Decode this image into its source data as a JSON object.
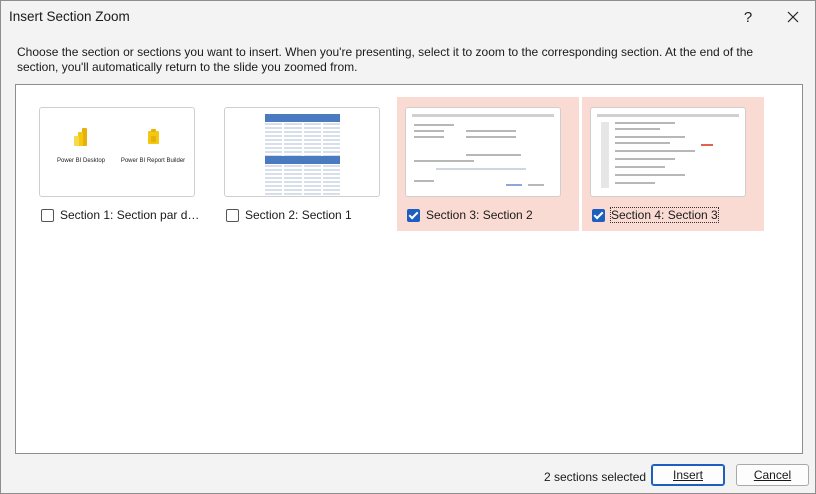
{
  "window": {
    "title": "Insert Section Zoom",
    "help_label": "?",
    "close_label": "✕"
  },
  "instruction": "Choose the section or sections you want to insert. When you're presenting, select it to zoom to the corresponding section. At the end of the section, you'll automatically return to the slide you zoomed from.",
  "sections": [
    {
      "label": "Section 1: Section par dé…",
      "checked": false,
      "thumb": {
        "left_title": "Power BI Desktop",
        "right_title": "Power BI Report Builder"
      }
    },
    {
      "label": "Section 2: Section 1",
      "checked": false
    },
    {
      "label": "Section 3: Section 2",
      "checked": true
    },
    {
      "label": "Section 4: Section 3",
      "checked": true
    }
  ],
  "footer": {
    "status": "2 sections selected",
    "insert_label": "Insert",
    "cancel_label": "Cancel"
  },
  "colors": {
    "selected_tile": "#fadbd3",
    "checkbox_accent": "#1c5fbf",
    "powerbi_yellow": "#f2c811"
  }
}
